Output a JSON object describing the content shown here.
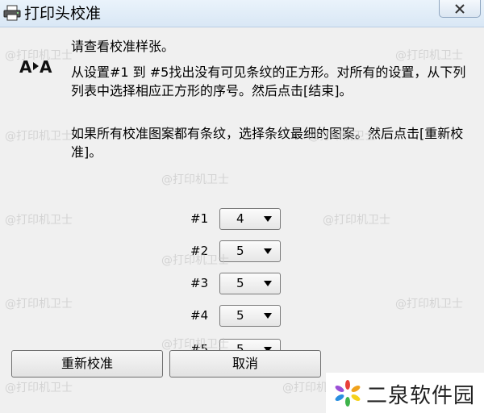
{
  "window": {
    "title": "打印头校准",
    "close_label": "×"
  },
  "content": {
    "heading": "请查看校准样张。",
    "paragraph1": "从设置#1 到 #5找出没有可见条纹的正方形。对所有的设置，从下列列表中选择相应正方形的序号。然后点击[结束]。",
    "paragraph2": "如果所有校准图案都有条纹，选择条纹最细的图案。然后点击[重新校准]。"
  },
  "settings": [
    {
      "label": "#1",
      "value": "4"
    },
    {
      "label": "#2",
      "value": "5"
    },
    {
      "label": "#3",
      "value": "5"
    },
    {
      "label": "#4",
      "value": "5"
    },
    {
      "label": "#5",
      "value": "5"
    }
  ],
  "buttons": {
    "recalibrate": "重新校准",
    "cancel": "取消"
  },
  "watermark": {
    "text": "@打印机卫士"
  },
  "brand": {
    "name": "二泉软件园"
  }
}
